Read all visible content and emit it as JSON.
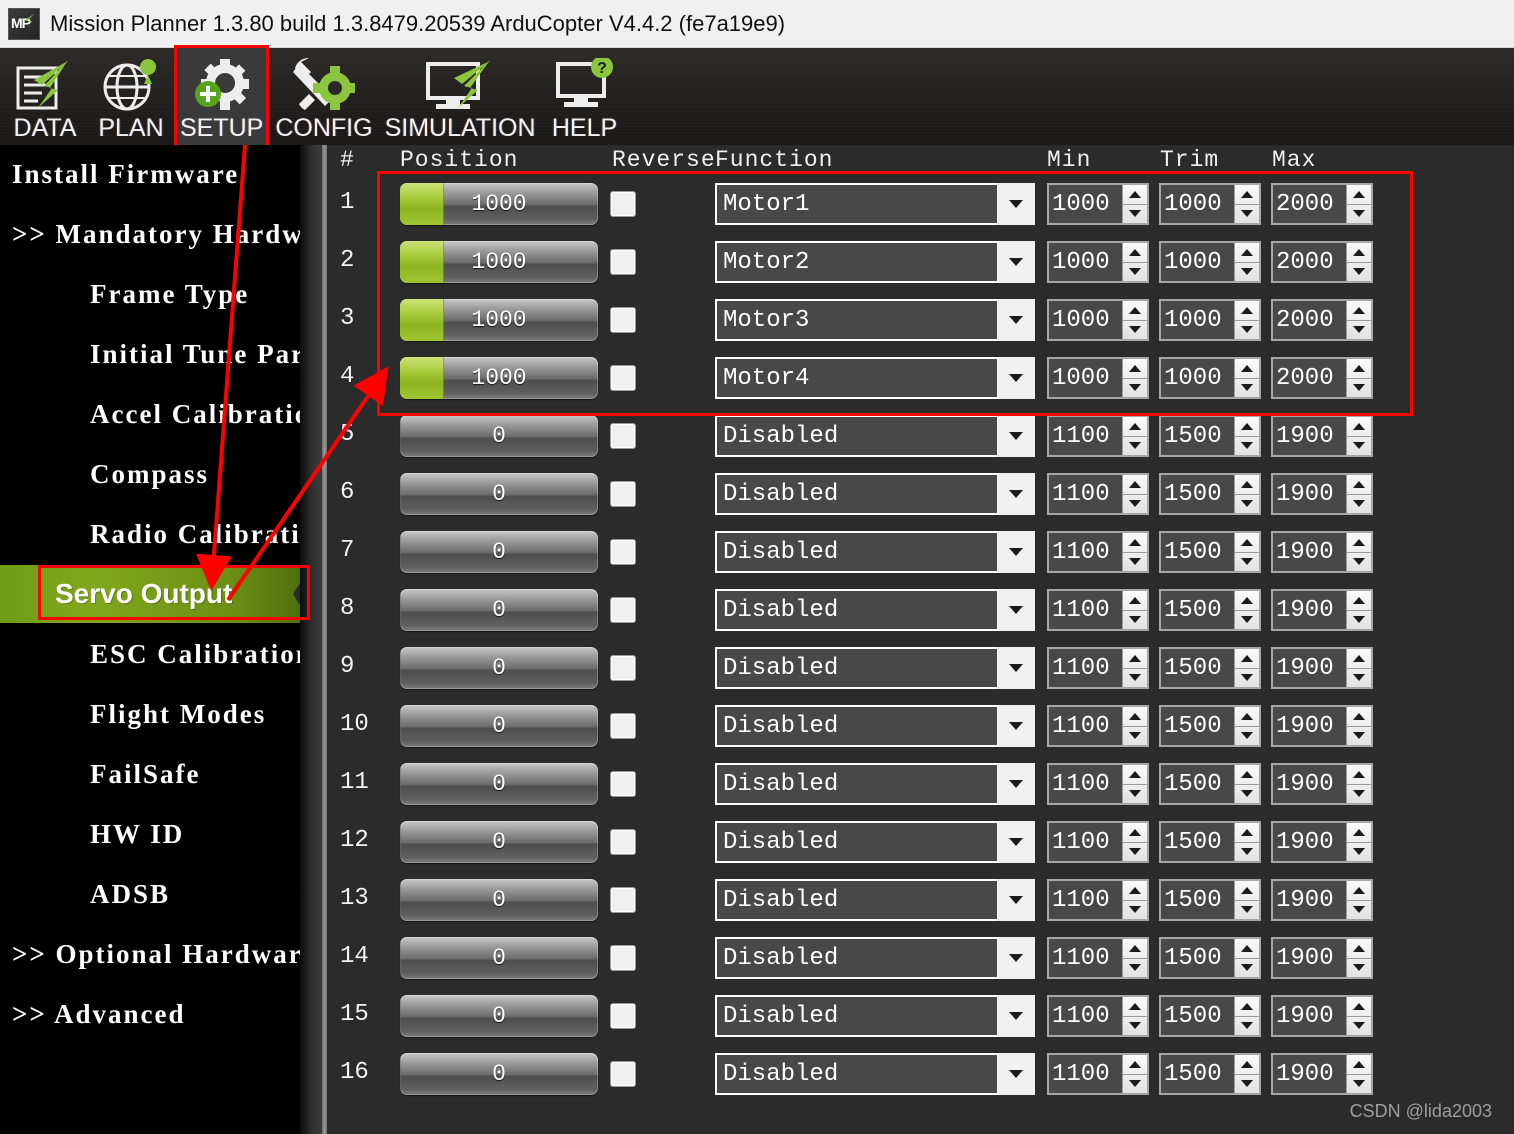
{
  "window": {
    "title": "Mission Planner 1.3.80 build 1.3.8479.20539 ArduCopter V4.4.2 (fe7a19e9)",
    "logo_text": "MP",
    "logo_icon": "mission-planner-logo-icon"
  },
  "toolbar": {
    "items": [
      {
        "label": "DATA",
        "icon": "data-document-plane-icon",
        "selected": false
      },
      {
        "label": "PLAN",
        "icon": "plan-globe-pin-icon",
        "selected": false
      },
      {
        "label": "SETUP",
        "icon": "setup-gear-plus-icon",
        "selected": true
      },
      {
        "label": "CONFIG",
        "icon": "config-wrench-gear-icon",
        "selected": false
      },
      {
        "label": "SIMULATION",
        "icon": "simulation-monitor-plane-icon",
        "selected": false
      },
      {
        "label": "HELP",
        "icon": "help-monitor-question-icon",
        "selected": false
      }
    ]
  },
  "sidebar": {
    "items": [
      {
        "label": "Install Firmware",
        "level": 0,
        "expander": "",
        "selected": false
      },
      {
        "label": "Mandatory Hardware",
        "level": 0,
        "expander": ">>",
        "selected": false
      },
      {
        "label": "Frame Type",
        "level": 1,
        "expander": "",
        "selected": false
      },
      {
        "label": "Initial Tune Para",
        "level": 1,
        "expander": "",
        "selected": false
      },
      {
        "label": "Accel Calibration",
        "level": 1,
        "expander": "",
        "selected": false
      },
      {
        "label": "Compass",
        "level": 1,
        "expander": "",
        "selected": false
      },
      {
        "label": "Radio Calibration",
        "level": 1,
        "expander": "",
        "selected": false
      },
      {
        "label": "Servo Output",
        "level": 1,
        "expander": "",
        "selected": true
      },
      {
        "label": "ESC Calibration",
        "level": 1,
        "expander": "",
        "selected": false
      },
      {
        "label": "Flight Modes",
        "level": 1,
        "expander": "",
        "selected": false
      },
      {
        "label": "FailSafe",
        "level": 1,
        "expander": "",
        "selected": false
      },
      {
        "label": "HW ID",
        "level": 1,
        "expander": "",
        "selected": false
      },
      {
        "label": "ADSB",
        "level": 1,
        "expander": "",
        "selected": false
      },
      {
        "label": "Optional Hardware",
        "level": 0,
        "expander": ">>",
        "selected": false
      },
      {
        "label": "Advanced",
        "level": 0,
        "expander": ">>",
        "selected": false
      }
    ]
  },
  "table": {
    "headers": {
      "num": "#",
      "position": "Position",
      "reverse": "Reverse",
      "function": "Function",
      "min": "Min",
      "trim": "Trim",
      "max": "Max"
    },
    "rows": [
      {
        "num": "1",
        "position": "1000",
        "fill_pct": 22,
        "reverse": false,
        "function": "Motor1",
        "min": "1000",
        "trim": "1000",
        "max": "2000"
      },
      {
        "num": "2",
        "position": "1000",
        "fill_pct": 22,
        "reverse": false,
        "function": "Motor2",
        "min": "1000",
        "trim": "1000",
        "max": "2000"
      },
      {
        "num": "3",
        "position": "1000",
        "fill_pct": 22,
        "reverse": false,
        "function": "Motor3",
        "min": "1000",
        "trim": "1000",
        "max": "2000"
      },
      {
        "num": "4",
        "position": "1000",
        "fill_pct": 22,
        "reverse": false,
        "function": "Motor4",
        "min": "1000",
        "trim": "1000",
        "max": "2000"
      },
      {
        "num": "5",
        "position": "0",
        "fill_pct": 0,
        "reverse": false,
        "function": "Disabled",
        "min": "1100",
        "trim": "1500",
        "max": "1900"
      },
      {
        "num": "6",
        "position": "0",
        "fill_pct": 0,
        "reverse": false,
        "function": "Disabled",
        "min": "1100",
        "trim": "1500",
        "max": "1900"
      },
      {
        "num": "7",
        "position": "0",
        "fill_pct": 0,
        "reverse": false,
        "function": "Disabled",
        "min": "1100",
        "trim": "1500",
        "max": "1900"
      },
      {
        "num": "8",
        "position": "0",
        "fill_pct": 0,
        "reverse": false,
        "function": "Disabled",
        "min": "1100",
        "trim": "1500",
        "max": "1900"
      },
      {
        "num": "9",
        "position": "0",
        "fill_pct": 0,
        "reverse": false,
        "function": "Disabled",
        "min": "1100",
        "trim": "1500",
        "max": "1900"
      },
      {
        "num": "10",
        "position": "0",
        "fill_pct": 0,
        "reverse": false,
        "function": "Disabled",
        "min": "1100",
        "trim": "1500",
        "max": "1900"
      },
      {
        "num": "11",
        "position": "0",
        "fill_pct": 0,
        "reverse": false,
        "function": "Disabled",
        "min": "1100",
        "trim": "1500",
        "max": "1900"
      },
      {
        "num": "12",
        "position": "0",
        "fill_pct": 0,
        "reverse": false,
        "function": "Disabled",
        "min": "1100",
        "trim": "1500",
        "max": "1900"
      },
      {
        "num": "13",
        "position": "0",
        "fill_pct": 0,
        "reverse": false,
        "function": "Disabled",
        "min": "1100",
        "trim": "1500",
        "max": "1900"
      },
      {
        "num": "14",
        "position": "0",
        "fill_pct": 0,
        "reverse": false,
        "function": "Disabled",
        "min": "1100",
        "trim": "1500",
        "max": "1900"
      },
      {
        "num": "15",
        "position": "0",
        "fill_pct": 0,
        "reverse": false,
        "function": "Disabled",
        "min": "1100",
        "trim": "1500",
        "max": "1900"
      },
      {
        "num": "16",
        "position": "0",
        "fill_pct": 0,
        "reverse": false,
        "function": "Disabled",
        "min": "1100",
        "trim": "1500",
        "max": "1900"
      }
    ]
  },
  "annotations": {
    "highlight_color": "#fe0000",
    "arrow_setup_to_servo": "arrow from SETUP tab down to Servo Output menu item",
    "arrow_servo_to_motors": "arrow from Servo Output menu item up-right to Motor rows 1-4"
  },
  "watermark": {
    "text": "CSDN @lida2003"
  },
  "colors": {
    "accent_green": "#80a81c",
    "panel_bg": "#2b2b2b",
    "sidebar_bg": "#000000",
    "annotation_red": "#fe0000"
  }
}
